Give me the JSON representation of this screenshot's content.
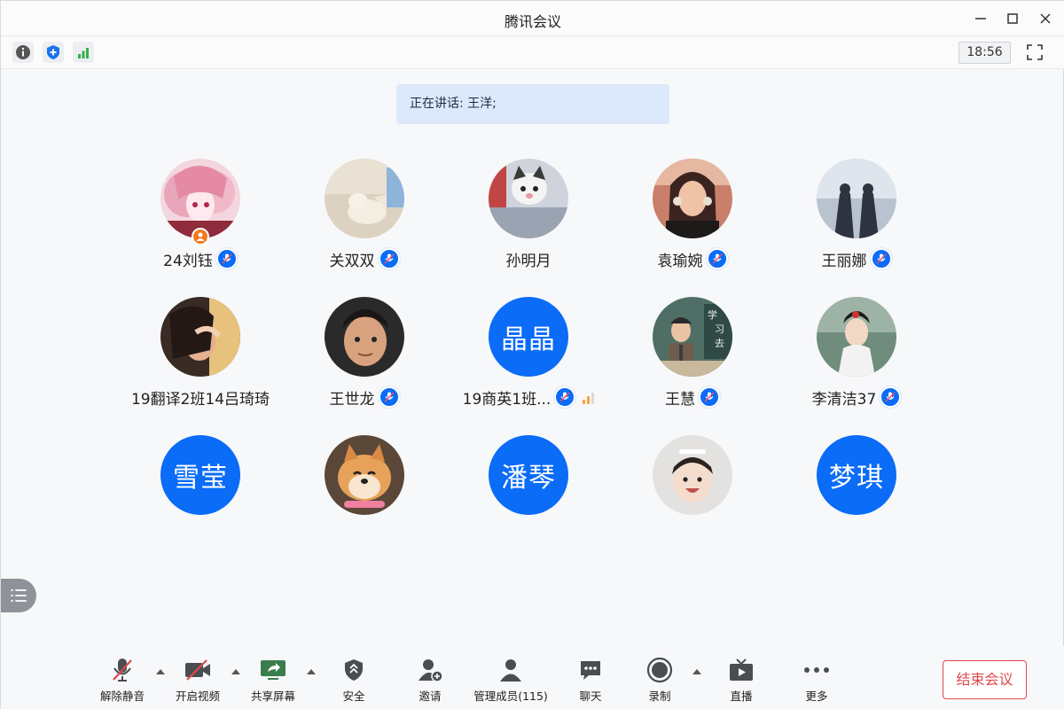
{
  "window": {
    "title": "腾讯会议"
  },
  "toolbar": {
    "clock": "18:56"
  },
  "speaking": {
    "text": "正在讲话: 王洋;"
  },
  "participants": [
    {
      "name": "24刘钰",
      "avatar_type": "photo",
      "mic": true,
      "host": true
    },
    {
      "name": "关双双",
      "avatar_type": "photo",
      "mic": true
    },
    {
      "name": "孙明月",
      "avatar_type": "photo",
      "mic": false
    },
    {
      "name": "袁瑜婉",
      "avatar_type": "photo",
      "mic": true
    },
    {
      "name": "王丽娜",
      "avatar_type": "photo",
      "mic": true
    },
    {
      "name": "19翻译2班14吕琦琦",
      "avatar_type": "photo",
      "mic": false
    },
    {
      "name": "王世龙",
      "avatar_type": "photo",
      "mic": true
    },
    {
      "name": "19商英1班...",
      "avatar_type": "text",
      "avatar_text": "晶晶",
      "mic": true,
      "signal": true
    },
    {
      "name": "王慧",
      "avatar_type": "photo",
      "mic": true
    },
    {
      "name": "李清洁37",
      "avatar_type": "photo",
      "mic": true
    },
    {
      "name": "",
      "avatar_type": "text",
      "avatar_text": "雪莹"
    },
    {
      "name": "",
      "avatar_type": "photo"
    },
    {
      "name": "",
      "avatar_type": "text",
      "avatar_text": "潘琴"
    },
    {
      "name": "",
      "avatar_type": "photo"
    },
    {
      "name": "",
      "avatar_type": "text",
      "avatar_text": "梦琪"
    }
  ],
  "bottombar": {
    "unmute": "解除静音",
    "start_video": "开启视频",
    "share_screen": "共享屏幕",
    "security": "安全",
    "invite": "邀请",
    "manage_members": "管理成员(115)",
    "chat": "聊天",
    "record": "录制",
    "live": "直播",
    "more": "更多",
    "end_meeting": "结束会议"
  },
  "colors": {
    "accent": "#0a6cf7",
    "end": "#e0484c",
    "speaking_bg": "#dce9fb"
  }
}
